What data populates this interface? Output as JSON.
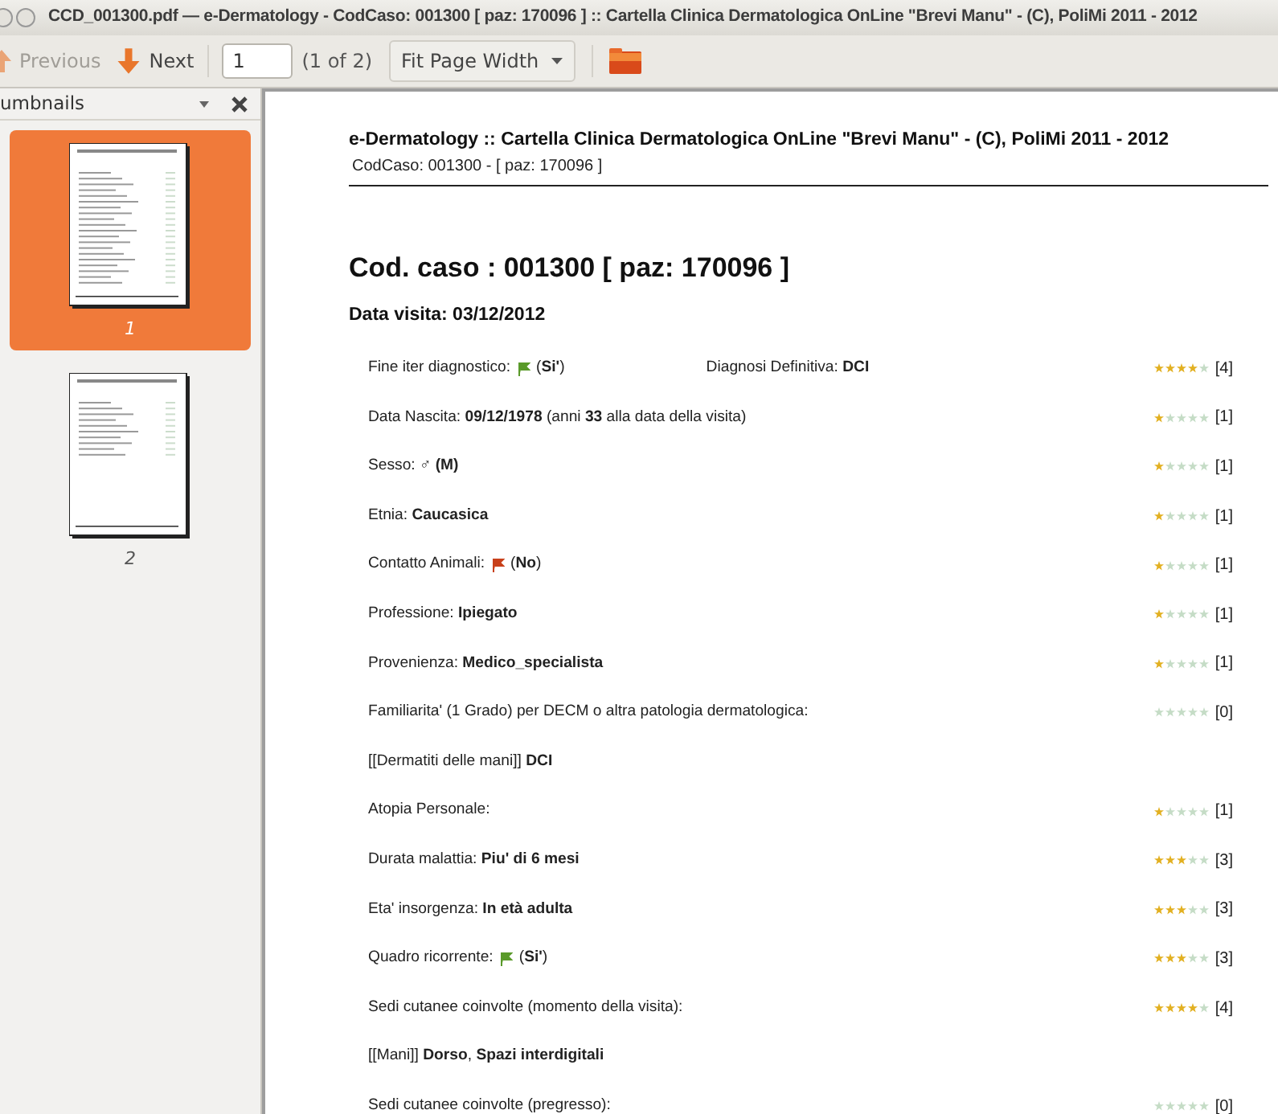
{
  "window": {
    "title": "CCD_001300.pdf — e-Dermatology - CodCaso: 001300 [ paz: 170096 ] :: Cartella Clinica Dermatologica OnLine \"Brevi Manu\" -  (C), PoliMi 2011 - 2012"
  },
  "toolbar": {
    "previous": {
      "label": "Previous",
      "disabled": true
    },
    "next": {
      "label": "Next",
      "disabled": false
    },
    "page_input": "1",
    "page_count": "(1 of 2)",
    "zoom": "Fit Page Width"
  },
  "sidebar": {
    "title": "umbnails",
    "thumbnails": [
      {
        "label": "1",
        "selected": true
      },
      {
        "label": "2",
        "selected": false
      }
    ]
  },
  "document": {
    "header": "e-Dermatology :: Cartella Clinica Dermatologica OnLine \"Brevi Manu\" -  (C), PoliMi 2011 - 2012",
    "subheader": "CodCaso: 001300 -  [ paz: 170096 ]",
    "heading": "Cod. caso : 001300 [ paz: 170096 ]",
    "visit_date": "Data visita: 03/12/2012",
    "rows": [
      {
        "label": "Fine iter diagnostico:",
        "color": "#5a9a2a",
        "value": "(**Si'**)",
        "extra": "Diagnosi Definitiva: **DCI**",
        "stars": 4,
        "score": "[4]"
      },
      {
        "label": "Data Nascita: **09/12/1978** (anni **33** alla data della visita)",
        "stars": 1,
        "score": "[1]"
      },
      {
        "label": "Sesso: ♂ **(M)**",
        "stars": 1,
        "score": "[1]"
      },
      {
        "label": "Etnia: **Caucasica**",
        "stars": 1,
        "score": "[1]"
      },
      {
        "label": "Contatto Animali:",
        "color": "#c8401a",
        "value": "(**No**)",
        "stars": 1,
        "score": "[1]"
      },
      {
        "label": "Professione: **Ipiegato**",
        "stars": 1,
        "score": "[1]"
      },
      {
        "label": "Provenienza: **Medico_specialista**",
        "stars": 1,
        "score": "[1]"
      },
      {
        "label": "Familiarita' (1 Grado) per DECM o altra patologia dermatologica:",
        "stars": 0,
        "score": "[0]"
      },
      {
        "label": "[[Dermatiti delle mani]] **DCI**"
      },
      {
        "label": "Atopia Personale:",
        "stars": 1,
        "score": "[1]"
      },
      {
        "label": "Durata malattia: **Piu' di 6 mesi**",
        "stars": 3,
        "score": "[3]"
      },
      {
        "label": "Eta' insorgenza: **In età adulta**",
        "stars": 3,
        "score": "[3]"
      },
      {
        "label": "Quadro ricorrente:",
        "color": "#5a9a2a",
        "value": "(**Si'**)",
        "stars": 3,
        "score": "[3]"
      },
      {
        "label": "Sedi cutanee coinvolte (momento della visita):",
        "stars": 4,
        "score": "[4]"
      },
      {
        "label": "[[Mani]] **Dorso**, **Spazi interdigitali**"
      },
      {
        "label": "Sedi cutanee coinvolte (pregresso):",
        "stars": 0,
        "score": "[0]"
      }
    ]
  }
}
